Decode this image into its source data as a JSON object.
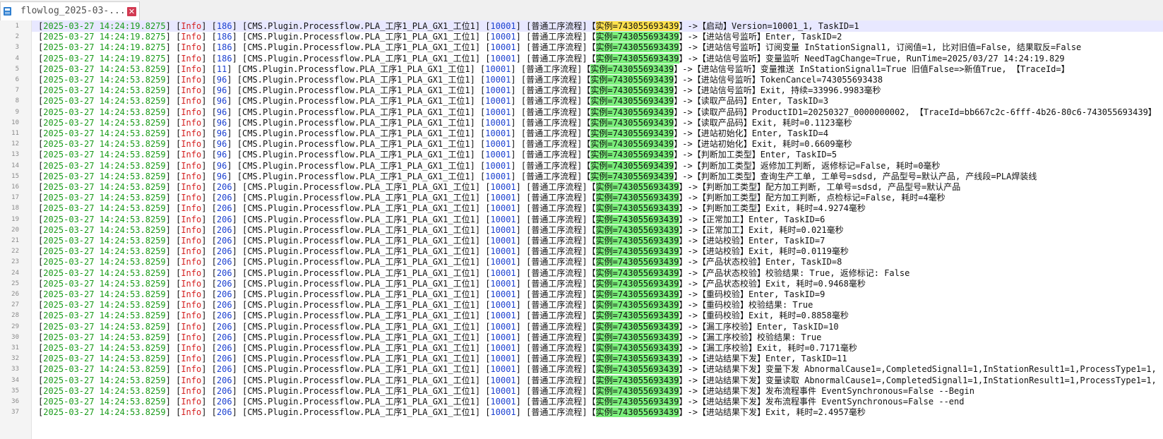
{
  "tab": {
    "title": "flowlog_2025-03-..."
  },
  "common": {
    "level": "Info",
    "module": "CMS.Plugin.Processflow.PLA_工序1_PLA_GX1_工位1",
    "code": "10001",
    "flow": "普通工序流程",
    "instance": "实例=743055693439"
  },
  "lines": [
    {
      "n": "1",
      "ts": "2025-03-27 14:24:19.8275",
      "tid": "186",
      "msg": "->【启动】Version=10001_1, TaskID=1"
    },
    {
      "n": "2",
      "ts": "2025-03-27 14:24:19.8275",
      "tid": "186",
      "msg": "->【进站信号监听】Enter, TaskID=2"
    },
    {
      "n": "3",
      "ts": "2025-03-27 14:24:19.8275",
      "tid": "186",
      "msg": "->【进站信号监听】订阅变量 InStationSignal1, 订阅值=1, 比对旧值=False, 结果取反=False"
    },
    {
      "n": "4",
      "ts": "2025-03-27 14:24:19.8275",
      "tid": "186",
      "msg": "->【进站信号监听】变量监听 NeedTagChange=True, RunTime=2025/03/27 14:24:19.829"
    },
    {
      "n": "5",
      "ts": "2025-03-27 14:24:53.8259",
      "tid": "11",
      "msg": "->【进站信号监听】变量推送 InStationSignal1=True 旧值False=>新值True, 【TraceId=】"
    },
    {
      "n": "6",
      "ts": "2025-03-27 14:24:53.8259",
      "tid": "96",
      "msg": "->【进站信号监听】TokenCancel=743055693438"
    },
    {
      "n": "7",
      "ts": "2025-03-27 14:24:53.8259",
      "tid": "96",
      "msg": "->【进站信号监听】Exit, 持续=33996.9983毫秒"
    },
    {
      "n": "8",
      "ts": "2025-03-27 14:24:53.8259",
      "tid": "96",
      "msg": "->【读取产品码】Enter, TaskID=3"
    },
    {
      "n": "9",
      "ts": "2025-03-27 14:24:53.8259",
      "tid": "96",
      "msg": "->【读取产品码】ProductID1=20250327_0000000002, 【TraceId=bb667c2c-6fff-4b26-80c6-743055693439】"
    },
    {
      "n": "10",
      "ts": "2025-03-27 14:24:53.8259",
      "tid": "96",
      "msg": "->【读取产品码】Exit, 耗时=0.1123毫秒"
    },
    {
      "n": "11",
      "ts": "2025-03-27 14:24:53.8259",
      "tid": "96",
      "msg": "->【进站初始化】Enter, TaskID=4"
    },
    {
      "n": "12",
      "ts": "2025-03-27 14:24:53.8259",
      "tid": "96",
      "msg": "->【进站初始化】Exit, 耗时=0.6609毫秒"
    },
    {
      "n": "13",
      "ts": "2025-03-27 14:24:53.8259",
      "tid": "96",
      "msg": "->【判断加工类型】Enter, TaskID=5"
    },
    {
      "n": "14",
      "ts": "2025-03-27 14:24:53.8259",
      "tid": "96",
      "msg": "->【判断加工类型】返修加工判断, 返修标记=False, 耗时=0毫秒"
    },
    {
      "n": "15",
      "ts": "2025-03-27 14:24:53.8259",
      "tid": "96",
      "msg": "->【判断加工类型】查询生产工单, 工单号=sdsd, 产品型号=默认产品, 产线段=PLA焊装线"
    },
    {
      "n": "16",
      "ts": "2025-03-27 14:24:53.8259",
      "tid": "206",
      "msg": "->【判断加工类型】配方加工判断, 工单号=sdsd, 产品型号=默认产品"
    },
    {
      "n": "17",
      "ts": "2025-03-27 14:24:53.8259",
      "tid": "206",
      "msg": "->【判断加工类型】配方加工判断, 点检标记=False, 耗时=4毫秒"
    },
    {
      "n": "18",
      "ts": "2025-03-27 14:24:53.8259",
      "tid": "206",
      "msg": "->【判断加工类型】Exit, 耗时=4.9274毫秒"
    },
    {
      "n": "19",
      "ts": "2025-03-27 14:24:53.8259",
      "tid": "206",
      "msg": "->【正常加工】Enter, TaskID=6"
    },
    {
      "n": "20",
      "ts": "2025-03-27 14:24:53.8259",
      "tid": "206",
      "msg": "->【正常加工】Exit, 耗时=0.021毫秒"
    },
    {
      "n": "21",
      "ts": "2025-03-27 14:24:53.8259",
      "tid": "206",
      "msg": "->【进站校验】Enter, TaskID=7"
    },
    {
      "n": "22",
      "ts": "2025-03-27 14:24:53.8259",
      "tid": "206",
      "msg": "->【进站校验】Exit, 耗时=0.0119毫秒"
    },
    {
      "n": "23",
      "ts": "2025-03-27 14:24:53.8259",
      "tid": "206",
      "msg": "->【产品状态校验】Enter, TaskID=8"
    },
    {
      "n": "24",
      "ts": "2025-03-27 14:24:53.8259",
      "tid": "206",
      "msg": "->【产品状态校验】校验结果: True, 返修标记: False"
    },
    {
      "n": "25",
      "ts": "2025-03-27 14:24:53.8259",
      "tid": "206",
      "msg": "->【产品状态校验】Exit, 耗时=0.9468毫秒"
    },
    {
      "n": "26",
      "ts": "2025-03-27 14:24:53.8259",
      "tid": "206",
      "msg": "->【重码校验】Enter, TaskID=9"
    },
    {
      "n": "27",
      "ts": "2025-03-27 14:24:53.8259",
      "tid": "206",
      "msg": "->【重码校验】校验结果: True"
    },
    {
      "n": "28",
      "ts": "2025-03-27 14:24:53.8259",
      "tid": "206",
      "msg": "->【重码校验】Exit, 耗时=0.8858毫秒"
    },
    {
      "n": "29",
      "ts": "2025-03-27 14:24:53.8259",
      "tid": "206",
      "msg": "->【漏工序校验】Enter, TaskID=10"
    },
    {
      "n": "30",
      "ts": "2025-03-27 14:24:53.8259",
      "tid": "206",
      "msg": "->【漏工序校验】校验结果: True"
    },
    {
      "n": "31",
      "ts": "2025-03-27 14:24:53.8259",
      "tid": "206",
      "msg": "->【漏工序校验】Exit, 耗时=0.7171毫秒"
    },
    {
      "n": "32",
      "ts": "2025-03-27 14:24:53.8259",
      "tid": "206",
      "msg": "->【进站结果下发】Enter, TaskID=11"
    },
    {
      "n": "33",
      "ts": "2025-03-27 14:24:53.8259",
      "tid": "206",
      "msg": "->【进站结果下发】变量下发 AbnormalCause1=,CompletedSignal1=1,InStationResult1=1,ProcessType1=1,"
    },
    {
      "n": "34",
      "ts": "2025-03-27 14:24:53.8259",
      "tid": "206",
      "msg": "->【进站结果下发】变量读取 AbnormalCause1=,CompletedSignal1=1,InStationResult1=1,ProcessType1=1,"
    },
    {
      "n": "35",
      "ts": "2025-03-27 14:24:53.8259",
      "tid": "206",
      "msg": "->【进站结果下发】发布流程事件 EventSynchronous=False --Begin"
    },
    {
      "n": "36",
      "ts": "2025-03-27 14:24:53.8259",
      "tid": "206",
      "msg": "->【进站结果下发】发布流程事件 EventSynchronous=False --end"
    },
    {
      "n": "37",
      "ts": "2025-03-27 14:24:53.8259",
      "tid": "206",
      "msg": "->【进站结果下发】Exit, 耗时=2.4957毫秒"
    }
  ]
}
